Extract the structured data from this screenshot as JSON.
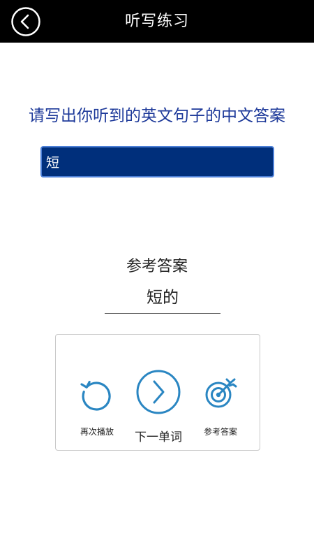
{
  "header": {
    "title": "听写练习",
    "back_icon": "chevron-left-icon"
  },
  "prompt": {
    "text": "请写出你听到的英文句子的中文答案"
  },
  "answer_input": {
    "value": "短"
  },
  "reference": {
    "label": "参考答案",
    "answer": "短的"
  },
  "controls": {
    "replay_label": "再次播放",
    "next_label": "下一单词",
    "reference_label": "参考答案"
  },
  "colors": {
    "header_bg": "#000000",
    "prompt_text": "#1e3a9a",
    "input_bg": "#002f7b",
    "icon_blue": "#2a86c2"
  }
}
